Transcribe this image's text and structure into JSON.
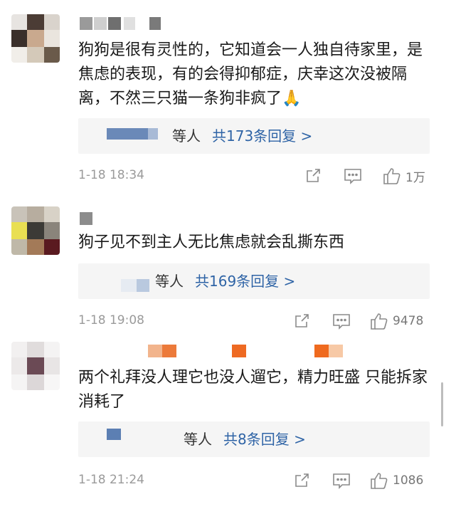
{
  "comments": [
    {
      "text": "狗狗是很有灵性的，它知道会一人独自待家里，是焦虑的表现，有的会得抑郁症，庆幸这次没被隔离，不然三只猫一条狗非疯了🙏",
      "reply_who": "等人",
      "reply_count": "共173条回复 >",
      "time": "1-18 18:34",
      "likes": "1万"
    },
    {
      "text": "狗子见不到主人无比焦虑就会乱撕东西",
      "reply_who": "等人",
      "reply_count": "共169条回复 >",
      "time": "1-18 19:08",
      "likes": "9478"
    },
    {
      "text": "两个礼拜没人理它也没人遛它，精力旺盛 只能拆家消耗了",
      "reply_who": "等人",
      "reply_count": "共8条回复 >",
      "time": "1-18 21:24",
      "likes": "1086"
    }
  ],
  "icons": {
    "share": "share-icon",
    "comment": "comment-icon",
    "like": "thumbs-up-icon"
  },
  "colors": {
    "reply_link": "#2f64a6",
    "reply_bg": "#f5f5f5",
    "meta_text": "#9a9a9a"
  }
}
